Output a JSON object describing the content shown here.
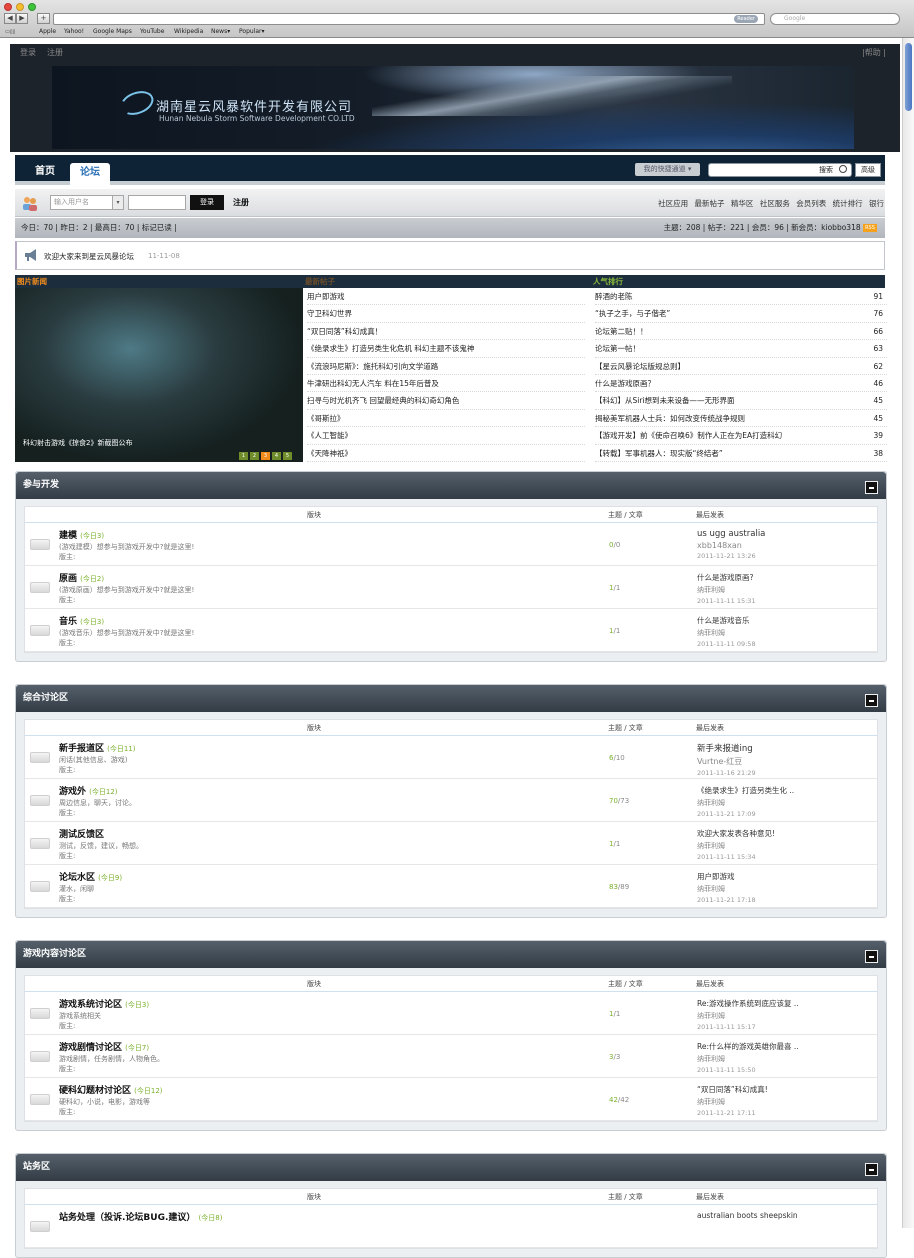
{
  "browser": {
    "reader": "Reader",
    "search_placeholder": "Google",
    "bookmarks": [
      "Apple",
      "Yahoo!",
      "Google Maps",
      "YouTube",
      "Wikipedia",
      "News▾",
      "Popular▾"
    ]
  },
  "topbar": {
    "login": "登录",
    "register": "注册",
    "help": "|帮助 |"
  },
  "banner": {
    "company_cn": "湖南星云风暴软件开发有限公司",
    "company_en": "Hunan Nebula Storm Software Development CO.LTD"
  },
  "nav": {
    "home": "首页",
    "forum": "论坛",
    "quick": "我的快捷通道 ▾",
    "search": "搜索",
    "advanced": "高级"
  },
  "login": {
    "username_placeholder": "输入用户名",
    "login_button": "登录",
    "register": "注册",
    "links": [
      "社区应用",
      "最新帖子",
      "精华区",
      "社区服务",
      "会员列表",
      "统计排行",
      "银行"
    ]
  },
  "stats": {
    "left": "今日：70 | 昨日：2 | 最高日：70 | 标记已读 |",
    "right": "主题：208 | 帖子：221 | 会员：96 | 新会员：kiobbo318",
    "rss": "RSS"
  },
  "announcement": {
    "text": "欢迎大家来到星云风暴论坛",
    "date": "11-11-08"
  },
  "blocks": {
    "picnews_title": "图片新闻",
    "latest_title": "最新帖子",
    "popular_title": "人气排行",
    "pic_caption": "科幻射击游戏《掠食2》新截图公布",
    "pages": [
      "1",
      "2",
      "3",
      "4",
      "5"
    ],
    "latest": [
      "用户即游戏",
      "守卫科幻世界",
      "“双日同落”科幻成真！",
      "《绝录求生》打造另类生化危机 科幻主题不该鬼神",
      "《流浪玛尼斯》：施托科幻引向文学道路",
      "牛津研出科幻无人汽车 料在15年后普及",
      "扫寻与时光机齐飞 回望最经典的科幻奇幻角色",
      "《哥斯拉》",
      "《人工智能》",
      "《天降神祇》"
    ],
    "popular": [
      {
        "title": "醉酒的老陈",
        "count": "91"
      },
      {
        "title": "“执子之手，与子偕老”",
        "count": "76"
      },
      {
        "title": "论坛第二贴！！",
        "count": "66"
      },
      {
        "title": "论坛第一帖！",
        "count": "63"
      },
      {
        "title": "【星云风暴论坛版规总则】",
        "count": "62"
      },
      {
        "title": "什么是游戏原画？",
        "count": "46"
      },
      {
        "title": "【科幻】从Siri想到未来设备——无形界面",
        "count": "45"
      },
      {
        "title": "揭秘美军机器人士兵：如何改变传统战争规则",
        "count": "45"
      },
      {
        "title": "【游戏开发】前《使命召唤6》制作人正在为EA打造科幻",
        "count": "39"
      },
      {
        "title": "【转载】军事机器人：现实版“终结者”",
        "count": "38"
      }
    ]
  },
  "columns": {
    "board": "版块",
    "topics": "主题 / 文章",
    "last": "最后发表"
  },
  "sections": [
    {
      "title": "参与开发",
      "forums": [
        {
          "name": "建模",
          "today": "(今日3)",
          "desc": "(游戏建模）想参与到游戏开发中?就是这里!",
          "mod": "版主:",
          "count_a": "0",
          "count_b": "/0",
          "last_title": "us ugg australia",
          "last_user": "xbb148xan",
          "last_time": "2011-11-21 13:26"
        },
        {
          "name": "原画",
          "today": "(今日2)",
          "desc": "(游戏原画）想参与到游戏开发中?就是这里!",
          "mod": "版主:",
          "count_a": "1",
          "count_b": "/1",
          "last_title": "什么是游戏原画?",
          "last_user": "纳菲利姆",
          "last_time": "2011-11-11 15:31"
        },
        {
          "name": "音乐",
          "today": "(今日3)",
          "desc": "(游戏音乐）想参与到游戏开发中?就是这里!",
          "mod": "版主:",
          "count_a": "1",
          "count_b": "/1",
          "last_title": "什么是游戏音乐",
          "last_user": "纳菲利姆",
          "last_time": "2011-11-11 09:58"
        }
      ]
    },
    {
      "title": "综合讨论区",
      "forums": [
        {
          "name": "新手报道区",
          "today": "(今日11)",
          "desc": "闲话(其他信息、游戏)",
          "mod": "版主:",
          "count_a": "6",
          "count_b": "/10",
          "last_title": "新手来报道ing",
          "last_user": "Vurtne-红豆",
          "last_time": "2011-11-16 21:29"
        },
        {
          "name": "游戏外",
          "today": "(今日12)",
          "desc": "周边信息，聊天，讨论。",
          "mod": "版主:",
          "count_a": "70",
          "count_b": "/73",
          "last_title": "《绝录求生》打造另类生化 ..",
          "last_user": "纳菲利姆",
          "last_time": "2011-11-21 17:09"
        },
        {
          "name": "测试反馈区",
          "today": "",
          "desc": "测试，反馈，建议，畅想。",
          "mod": "版主:",
          "count_a": "1",
          "count_b": "/1",
          "last_title": "欢迎大家发表各种意见!",
          "last_user": "纳菲利姆",
          "last_time": "2011-11-11 15:34"
        },
        {
          "name": "论坛水区",
          "today": "(今日9)",
          "desc": "灌水，闲聊",
          "mod": "版主:",
          "count_a": "83",
          "count_b": "/89",
          "last_title": "用户即游戏",
          "last_user": "纳菲利姆",
          "last_time": "2011-11-21 17:18"
        }
      ]
    },
    {
      "title": "游戏内容讨论区",
      "forums": [
        {
          "name": "游戏系统讨论区",
          "today": "(今日3)",
          "desc": "游戏系统相关",
          "mod": "版主:",
          "count_a": "1",
          "count_b": "/1",
          "last_title": "Re:游戏操作系统到底应该复 ..",
          "last_user": "纳菲利姆",
          "last_time": "2011-11-11 15:17"
        },
        {
          "name": "游戏剧情讨论区",
          "today": "(今日7)",
          "desc": "游戏剧情，任务剧情，人物角色。",
          "mod": "版主:",
          "count_a": "3",
          "count_b": "/3",
          "last_title": "Re:什么样的游戏英雄你最喜 ..",
          "last_user": "纳菲利姆",
          "last_time": "2011-11-11 15:50"
        },
        {
          "name": "硬科幻题材讨论区",
          "today": "(今日12)",
          "desc": "硬科幻，小说，电影，游戏等",
          "mod": "版主:",
          "count_a": "42",
          "count_b": "/42",
          "last_title": "“双日同落”科幻成真!",
          "last_user": "纳菲利姆",
          "last_time": "2011-11-21 17:11"
        }
      ]
    },
    {
      "title": "站务区",
      "forums": [
        {
          "name": "站务处理（投诉.论坛BUG.建议）",
          "today": "(今日8)",
          "desc": "",
          "mod": "",
          "count_a": "",
          "count_b": "",
          "last_title": "australian boots sheepskin",
          "last_user": "",
          "last_time": ""
        }
      ]
    }
  ]
}
